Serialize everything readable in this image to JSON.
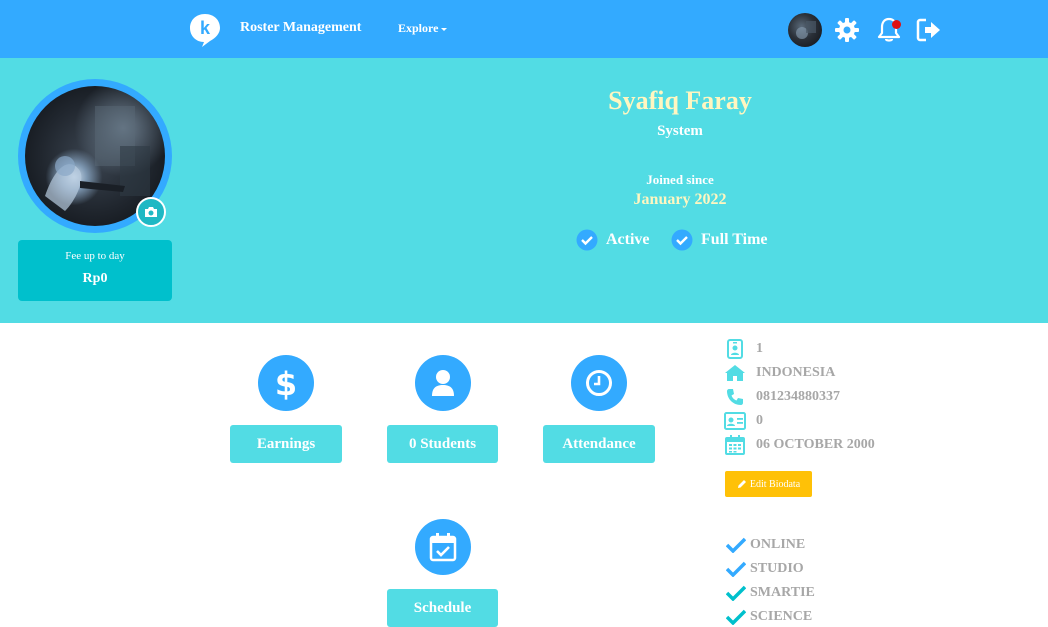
{
  "navbar": {
    "brand": "Roster Management",
    "explore_label": "Explore",
    "logo_letter": "k",
    "icons": [
      "gear-icon",
      "bell-icon",
      "logout-icon"
    ],
    "notification_dot": true
  },
  "profile": {
    "name": "Syafiq Faray",
    "role": "System",
    "joined_label": "Joined since",
    "joined_date": "January 2022",
    "statuses": [
      "Active",
      "Full Time"
    ]
  },
  "fee": {
    "label": "Fee up to day",
    "value": "Rp0"
  },
  "actions": [
    {
      "label": "Earnings",
      "icon": "dollar-icon"
    },
    {
      "label": "0 Students",
      "icon": "user-icon"
    },
    {
      "label": "Attendance",
      "icon": "clock-icon"
    },
    {
      "label": "Schedule",
      "icon": "calendar-check-icon"
    }
  ],
  "biodata": [
    {
      "icon": "id-badge-icon",
      "value": "1"
    },
    {
      "icon": "home-icon",
      "value": "INDONESIA"
    },
    {
      "icon": "phone-icon",
      "value": "081234880337"
    },
    {
      "icon": "id-card-icon",
      "value": "0"
    },
    {
      "icon": "calendar-icon",
      "value": "06 OCTOBER 2000"
    }
  ],
  "edit_biodata_label": "Edit Biodata",
  "categories": [
    {
      "label": "ONLINE",
      "check_color": "#33aaff"
    },
    {
      "label": "STUDIO",
      "check_color": "#33aaff"
    },
    {
      "label": "SMARTIE",
      "check_color": "#00c0cc"
    },
    {
      "label": "SCIENCE",
      "check_color": "#00c0cc"
    }
  ],
  "colors": {
    "navbar": "#33aaff",
    "hero": "#52dce4",
    "name_text": "#fff6c0",
    "fee_card": "#00c0cc",
    "edit_button": "#ffc107",
    "muted_text": "#a7a7a7"
  }
}
